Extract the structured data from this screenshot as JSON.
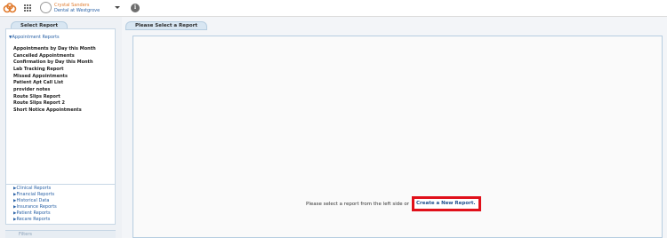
{
  "header": {
    "user_name": "Crystal Sanders",
    "practice_name": "Dental at Westgrove",
    "logo_icon": "brand-logo-icon",
    "apps_icon": "apps-grid-icon",
    "info_icon": "info-icon",
    "info_glyph": "i",
    "accent_color": "#e07b2e"
  },
  "left_panel": {
    "tab_label": "Select Report",
    "section_label": "Appointment Reports",
    "reports": [
      "Appointments by Day this Month",
      "Cancelled Appointments",
      "Confirmation by Day this Month",
      "Lab Tracking Report",
      "Missed Appointments",
      "Patient Apt Call List",
      "provider notes",
      "Route Slips Report",
      "Route Slips Report 2",
      "Short Notice Appointments"
    ],
    "categories": [
      "Clinical Reports",
      "Financial Reports",
      "Historical Data",
      "Insurance Reports",
      "Patient Reports",
      "Recare Reports"
    ],
    "filters_label": "Filters"
  },
  "main": {
    "tab_label": "Please Select a Report",
    "message": "Please select a report from the left side or",
    "create_label": "Create a New Report.",
    "highlight_color": "#e0101a"
  }
}
